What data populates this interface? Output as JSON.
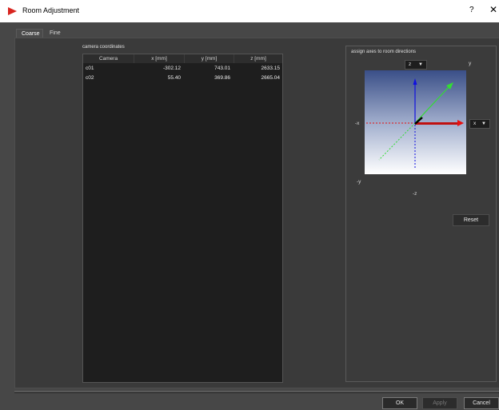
{
  "window": {
    "title": "Room Adjustment",
    "help": "?",
    "close": "✕"
  },
  "tabs": [
    {
      "label": "Coarse",
      "active": true
    },
    {
      "label": "Fine",
      "active": false
    }
  ],
  "camera_coordinates": {
    "label": "camera coordinates",
    "columns": [
      "Camera",
      "x [mm]",
      "y [mm]",
      "z [mm]"
    ],
    "rows": [
      {
        "camera": "c01",
        "x": "-302.12",
        "y": "743.01",
        "z": "2633.15"
      },
      {
        "camera": "c02",
        "x": "55.40",
        "y": "369.86",
        "z": "2665.04"
      }
    ]
  },
  "axes_panel": {
    "title": "assign axes to room directions",
    "top_dropdown": {
      "value": "z"
    },
    "right_dropdown": {
      "value": "x"
    },
    "labels": {
      "y": "y",
      "neg_x": "-x",
      "neg_y": "-y",
      "neg_z": "-z"
    },
    "reset_label": "Reset"
  },
  "footer": {
    "ok_label": "OK",
    "apply_label": "Apply",
    "cancel_label": "Cancel"
  },
  "colors": {
    "x_axis": "#e81010",
    "y_axis": "#33dd33",
    "z_axis": "#1010e0",
    "viewport_top": "#3a4f88",
    "viewport_bottom": "#ffffff"
  }
}
